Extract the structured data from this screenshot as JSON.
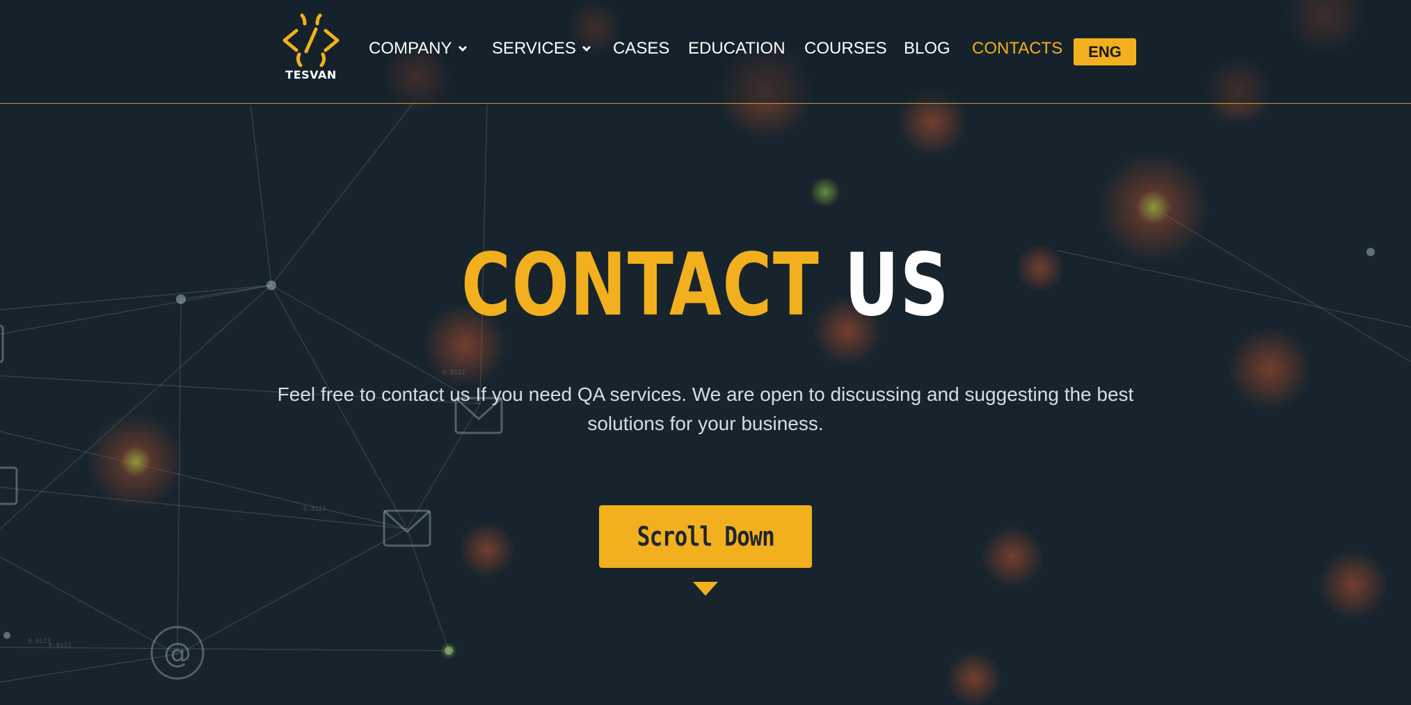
{
  "brand": {
    "name": "TESVAN"
  },
  "nav": {
    "items": [
      {
        "label": "COMPANY",
        "dropdown": true,
        "active": false
      },
      {
        "label": "SERVICES",
        "dropdown": true,
        "active": false
      },
      {
        "label": "CASES",
        "dropdown": false,
        "active": false
      },
      {
        "label": "EDUCATION",
        "dropdown": false,
        "active": false
      },
      {
        "label": "COURSES",
        "dropdown": false,
        "active": false
      },
      {
        "label": "BLOG",
        "dropdown": false,
        "active": false
      },
      {
        "label": "CONTACTS",
        "dropdown": false,
        "active": true
      }
    ],
    "language": "ENG"
  },
  "hero": {
    "title_part1": "CONTACT",
    "title_part2": "US",
    "subtitle": "Feel free to contact us If you need QA services. We are open to discussing and suggesting the best solutions for your business.",
    "cta_label": "Scroll Down"
  },
  "background": {
    "small_labels": [
      "0.8122",
      "0.8123",
      "0.0123",
      "0.8123"
    ]
  },
  "colors": {
    "accent": "#f2b01e",
    "background": "#17242d",
    "text": "#ffffff",
    "subtext": "#d8dde0"
  }
}
